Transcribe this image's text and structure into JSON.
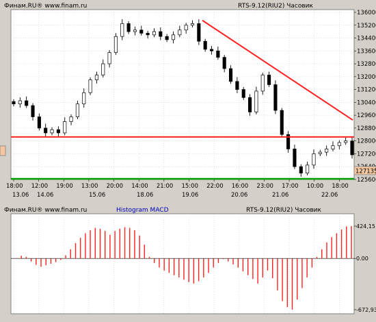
{
  "header": {
    "price_source": "Финам.RU®  www.finam.ru",
    "price_instrument": "RTS-9.12(RIU2) Часовик",
    "macd_source": "Финам.RU® www.finam.ru",
    "macd_title": "Histogram MACD",
    "macd_instrument": "RTS-9.12(RIU2) Часовик"
  },
  "colors": {
    "background": "#d4d0c8",
    "plot_bg": "#ffffff",
    "grid": "#c0c0c0",
    "trendline": "#ff2020",
    "support": "#ff2020",
    "bottom_line": "#00a000",
    "histogram": "#ff2020",
    "current_price_box": "#f4c7a0",
    "candle": "#000000"
  },
  "chart_data": [
    {
      "type": "candlestick",
      "title": "RTS-9.12(RIU2) Часовик",
      "ylim": [
        125600,
        136000
      ],
      "y_ticks": [
        "136000",
        "135200",
        "134400",
        "133600",
        "132800",
        "132000",
        "131200",
        "130400",
        "129600",
        "128800",
        "128000",
        "127200",
        "126400",
        "125600"
      ],
      "extra_price_labels": [
        "134400",
        "133600"
      ],
      "current_price": "127135",
      "x_tick_labels": [
        "18:00",
        "12:00",
        "19:00",
        "13:00",
        "20:00",
        "14:00",
        "21:00",
        "15:00",
        "22:00",
        "16:00",
        "23:00",
        "17:00",
        "10:00",
        "18:00"
      ],
      "date_labels": [
        "13.06",
        "14.06",
        "15.06",
        "18.06",
        "19.06",
        "20.06",
        "21.06",
        "22.06"
      ],
      "close_path": [
        130300,
        130500,
        130200,
        129500,
        128800,
        128500,
        128700,
        128500,
        129200,
        129500,
        130300,
        131000,
        131800,
        132100,
        132800,
        133500,
        134500,
        135300,
        134800,
        134900,
        134700,
        134600,
        134800,
        134500,
        134300,
        134600,
        134900,
        135200,
        135300,
        134200,
        133700,
        133600,
        133200,
        132500,
        131700,
        131200,
        130700,
        129800,
        131100,
        132100,
        131500,
        129900,
        128400,
        127500,
        126400,
        126000,
        126500,
        127200,
        127300,
        127500,
        127700,
        127900,
        128000,
        127135
      ],
      "trendline": {
        "from": 135500,
        "to": 129300
      },
      "support_level": 128250
    },
    {
      "type": "bar",
      "title": "Histogram MACD",
      "ylim": [
        -672.93,
        424.15
      ],
      "y_ticks": [
        "424,15",
        "0.00",
        "-672,93"
      ],
      "values": [
        5,
        35,
        20,
        -40,
        -85,
        -110,
        -90,
        -70,
        -50,
        -20,
        40,
        120,
        200,
        270,
        330,
        370,
        400,
        390,
        360,
        310,
        360,
        390,
        410,
        400,
        370,
        300,
        180,
        20,
        -60,
        -120,
        -160,
        -190,
        -220,
        -250,
        -280,
        -310,
        -330,
        -300,
        -250,
        -190,
        -120,
        -60,
        -10,
        -40,
        -80,
        -120,
        -170,
        -220,
        -270,
        -330,
        -250,
        -160,
        -260,
        -420,
        -560,
        -640,
        -672,
        -540,
        -390,
        -250,
        -120,
        20,
        120,
        210,
        280,
        330,
        380,
        420,
        424
      ]
    }
  ]
}
